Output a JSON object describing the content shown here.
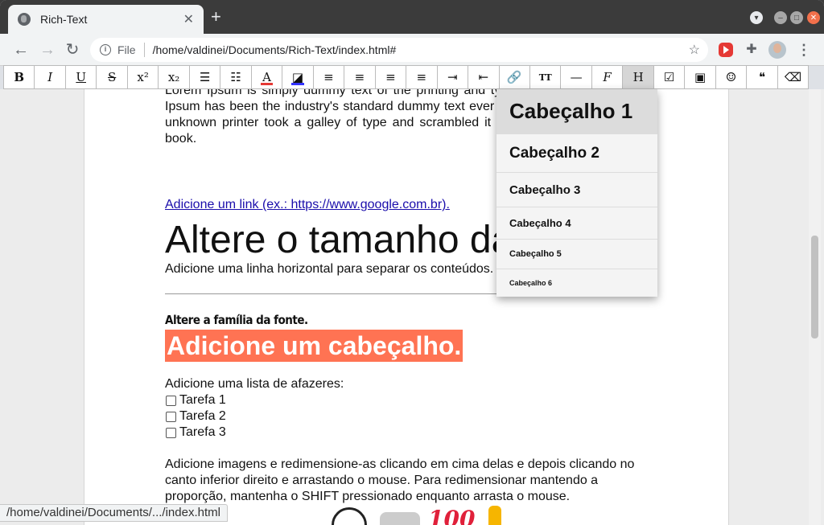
{
  "browser": {
    "tab_title": "Rich-Text",
    "tab_close": "✕",
    "new_tab": "+",
    "omnibox_scheme": "File",
    "omnibox_url": "/home/valdinei/Documents/Rich-Text/index.html#",
    "status_url": "/home/valdinei/Documents/.../index.html"
  },
  "toolbar": {
    "buttons": [
      {
        "name": "bold-button",
        "label": "B"
      },
      {
        "name": "italic-button",
        "label": "I"
      },
      {
        "name": "underline-button",
        "label": "U"
      },
      {
        "name": "strikethrough-button",
        "label": "S"
      },
      {
        "name": "superscript-button",
        "label": "x²"
      },
      {
        "name": "subscript-button",
        "label": "x₂"
      },
      {
        "name": "bulleted-list-button",
        "label": "☰"
      },
      {
        "name": "numbered-list-button",
        "label": "☷"
      },
      {
        "name": "font-color-button",
        "label": "A"
      },
      {
        "name": "highlight-color-button",
        "label": "◪"
      },
      {
        "name": "align-left-button",
        "label": "≡"
      },
      {
        "name": "align-center-button",
        "label": "≡"
      },
      {
        "name": "align-right-button",
        "label": "≡"
      },
      {
        "name": "align-justify-button",
        "label": "≡"
      },
      {
        "name": "indent-button",
        "label": "⇥"
      },
      {
        "name": "outdent-button",
        "label": "⇤"
      },
      {
        "name": "link-button",
        "label": "🔗"
      },
      {
        "name": "font-size-button",
        "label": "TT"
      },
      {
        "name": "horizontal-rule-button",
        "label": "—"
      },
      {
        "name": "font-family-button",
        "label": "F"
      },
      {
        "name": "heading-button",
        "label": "H"
      },
      {
        "name": "checkbox-button",
        "label": "☑"
      },
      {
        "name": "image-button",
        "label": "▣"
      },
      {
        "name": "emoji-button",
        "label": "☺"
      },
      {
        "name": "quote-button",
        "label": "❝"
      },
      {
        "name": "eraser-button",
        "label": "⌫"
      }
    ],
    "font_color": "#e53935",
    "highlight_color": "#3333ff"
  },
  "content": {
    "lorem": "Lorem Ipsum is simply dummy text of the printing and typesetting industry. Lorem Ipsum has been the industry's standard dummy text ever since the 1500s, when an unknown printer took a galley of type and scrambled it to make a type specimen book.",
    "link_text": "Adicione um link (ex.: https://www.google.com.br).",
    "big_text": "Altere o tamanho da fonte.",
    "hr_text": "Adicione uma linha horizontal para separar os conteúdos.",
    "font_family_text": "Altere a família da fonte.",
    "heading_text": "Adicione um cabeçalho.",
    "todo_intro": "Adicione uma lista de afazeres:",
    "todos": [
      "Tarefa 1",
      "Tarefa 2",
      "Tarefa 3"
    ],
    "image_intro": "Adicione imagens e redimensione-as clicando em cima delas e depois clicando no canto inferior direito e arrastando o mouse. Para redimensionar mantendo a proporção, mantenha o SHIFT pressionado enquanto arrasta o mouse.",
    "image_label": "100",
    "heading_highlight": "#ff7353"
  },
  "heading_menu": {
    "items": [
      "Cabeçalho 1",
      "Cabeçalho 2",
      "Cabeçalho 3",
      "Cabeçalho 4",
      "Cabeçalho 5",
      "Cabeçalho 6"
    ]
  }
}
